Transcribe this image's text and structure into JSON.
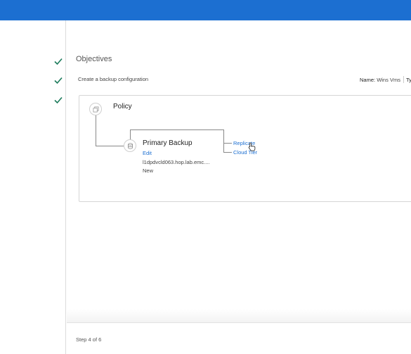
{
  "colors": {
    "topbar": "#1c6fd1",
    "link": "#1c6fd1",
    "check": "#1a7a5a"
  },
  "steps": [
    {
      "status": "completed",
      "icon": "check-icon"
    },
    {
      "status": "completed",
      "icon": "check-icon"
    },
    {
      "status": "completed",
      "icon": "check-icon"
    }
  ],
  "page": {
    "title": "Objectives",
    "subtitle": "Create a backup configuration",
    "name_label": "Name:",
    "name_value": "Wins Vms",
    "type_label_partial": "Ty"
  },
  "policy": {
    "label": "Policy",
    "icon": "copy-icon",
    "primary": {
      "title": "Primary Backup",
      "icon": "database-icon",
      "edit_label": "Edit",
      "host": "l1dpdvcld063.hop.lab.emc....",
      "status": "New"
    },
    "links": {
      "replicate": "Replicate",
      "cloud_tier": "Cloud Tier"
    }
  },
  "footer": {
    "step_text": "Step 4 of 6"
  }
}
